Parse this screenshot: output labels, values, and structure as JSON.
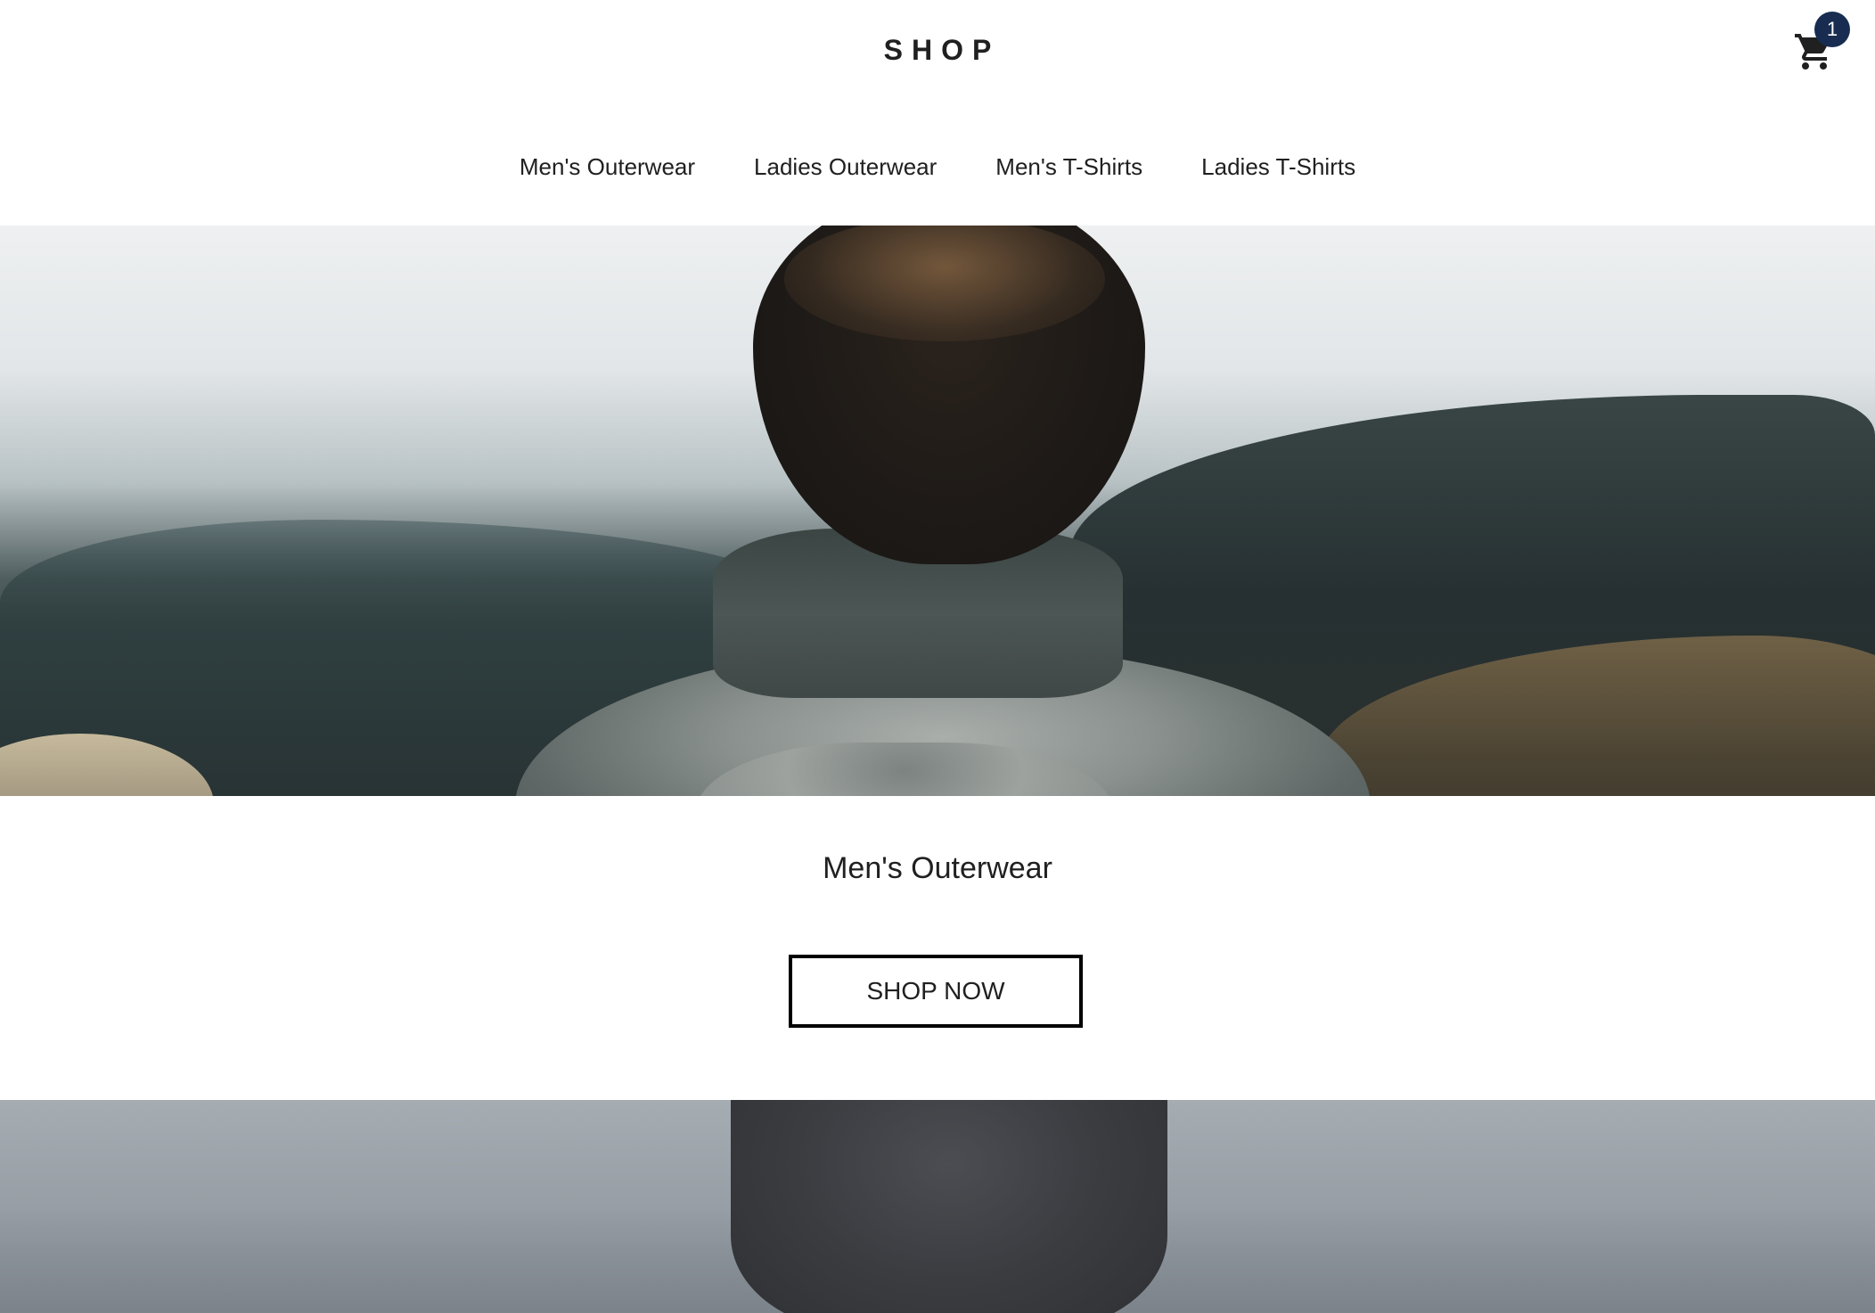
{
  "header": {
    "logo": "SHOP",
    "cart": {
      "icon": "shopping-cart-icon",
      "badge_count": "1",
      "badge_color": "#172c50"
    },
    "nav": [
      {
        "label": "Men's Outerwear"
      },
      {
        "label": "Ladies Outerwear"
      },
      {
        "label": "Men's T-Shirts"
      },
      {
        "label": "Ladies T-Shirts"
      }
    ]
  },
  "hero": {
    "image": "person-in-grey-sweater-facing-foggy-forest"
  },
  "category": {
    "title": "Men's Outerwear",
    "button_label": "SHOP NOW"
  },
  "hero2": {
    "image": "person-in-knit-sweater-foggy-background"
  }
}
